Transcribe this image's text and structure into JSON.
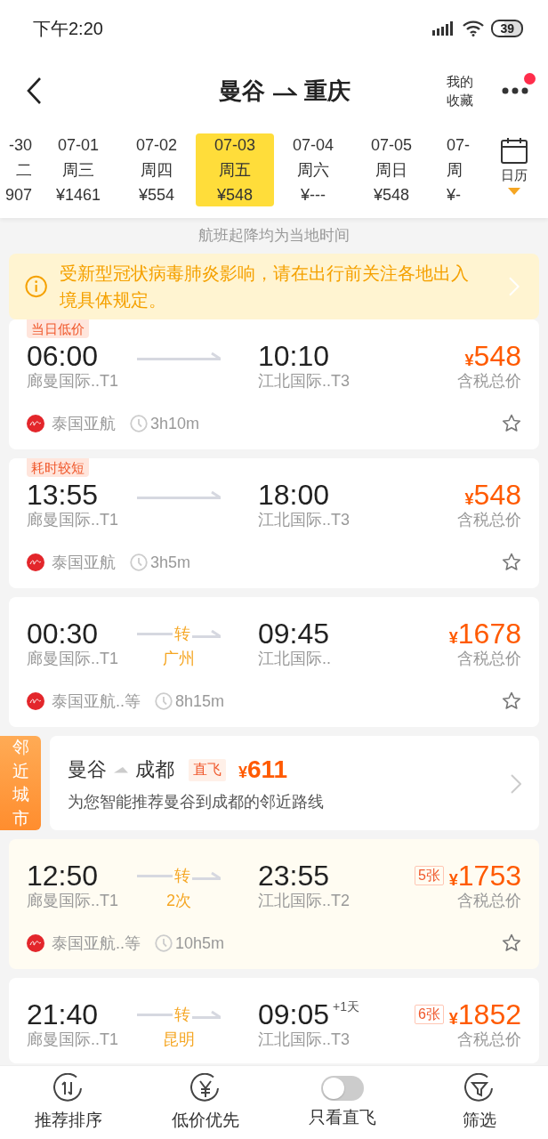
{
  "status_bar": {
    "time": "下午2:20",
    "battery": "39"
  },
  "header": {
    "from": "曼谷",
    "to": "重庆",
    "favorites": "我的收藏",
    "has_notification": true
  },
  "dates": [
    {
      "kind": "cut-left",
      "date": "-30",
      "weekday": "二",
      "price": "907",
      "selected": false
    },
    {
      "kind": "full",
      "date": "07-01",
      "weekday": "周三",
      "price": "¥1461",
      "selected": false
    },
    {
      "kind": "full",
      "date": "07-02",
      "weekday": "周四",
      "price": "¥554",
      "selected": false
    },
    {
      "kind": "full",
      "date": "07-03",
      "weekday": "周五",
      "price": "¥548",
      "selected": true
    },
    {
      "kind": "full",
      "date": "07-04",
      "weekday": "周六",
      "price": "¥---",
      "selected": false
    },
    {
      "kind": "full",
      "date": "07-05",
      "weekday": "周日",
      "price": "¥548",
      "selected": false
    },
    {
      "kind": "cut-right",
      "date": "07-",
      "weekday": "周",
      "price": "¥-",
      "selected": false
    }
  ],
  "calendar": {
    "label": "日历"
  },
  "notice": "航班起降均为当地时间",
  "alert": {
    "text": "受新型冠状病毒肺炎影响，请在出行前关注各地出入境具体规定。"
  },
  "results": [
    {
      "kind": "flight",
      "tag": "当日低价",
      "dep_time": "06:00",
      "dep_airport": "廊曼国际..T1",
      "arr_time": "10:10",
      "arr_airport": "江北国际..T3",
      "currency": "¥",
      "price": "548",
      "price_note": "含税总价",
      "airline": "泰国亚航",
      "duration": "3h10m",
      "highlighted": false
    },
    {
      "kind": "flight",
      "tag": "耗时较短",
      "dep_time": "13:55",
      "dep_airport": "廊曼国际..T1",
      "arr_time": "18:00",
      "arr_airport": "江北国际..T3",
      "currency": "¥",
      "price": "548",
      "price_note": "含税总价",
      "airline": "泰国亚航",
      "duration": "3h5m",
      "highlighted": false
    },
    {
      "kind": "flight",
      "dep_time": "00:30",
      "dep_airport": "廊曼国际..T1",
      "transfer": "转",
      "transfer_place": "广州",
      "arr_time": "09:45",
      "arr_airport": "江北国际..",
      "currency": "¥",
      "price": "1678",
      "price_note": "含税总价",
      "airline": "泰国亚航..等",
      "duration": "8h15m",
      "highlighted": false
    },
    {
      "kind": "nearby",
      "side_label": "邻近城市",
      "from": "曼谷",
      "to": "成都",
      "badge": "直飞",
      "currency": "¥",
      "price": "611",
      "subtitle": "为您智能推荐曼谷到成都的邻近路线"
    },
    {
      "kind": "flight",
      "dep_time": "12:50",
      "dep_airport": "廊曼国际..T1",
      "transfer": "转",
      "transfer_place": "2次",
      "arr_time": "23:55",
      "arr_airport": "江北国际..T2",
      "tickets": "5张",
      "currency": "¥",
      "price": "1753",
      "price_note": "含税总价",
      "airline": "泰国亚航..等",
      "duration": "10h5m",
      "highlighted": true
    },
    {
      "kind": "flight",
      "dep_time": "21:40",
      "dep_airport": "廊曼国际..T1",
      "transfer": "转",
      "transfer_place": "昆明",
      "arr_time": "09:05",
      "next_day": "+1天",
      "arr_airport": "江北国际..T3",
      "tickets": "6张",
      "currency": "¥",
      "price": "1852",
      "price_note": "含税总价",
      "highlighted": false
    }
  ],
  "bottom_bar": [
    {
      "kind": "sort",
      "label": "推荐排序"
    },
    {
      "kind": "price",
      "label": "低价优先"
    },
    {
      "kind": "toggle",
      "label": "只看直飞",
      "on": false
    },
    {
      "kind": "filter",
      "label": "筛选"
    }
  ]
}
